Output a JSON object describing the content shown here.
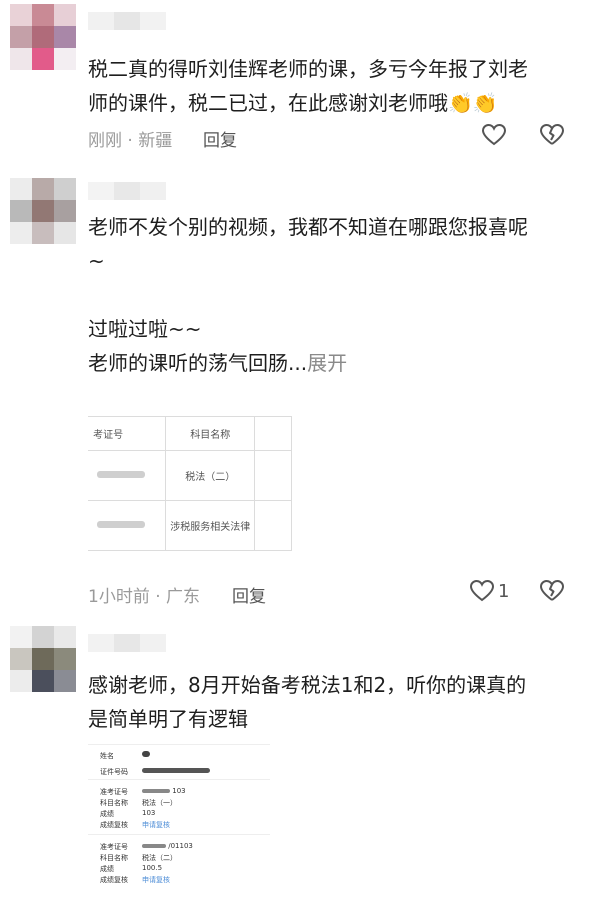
{
  "comments": [
    {
      "lines": [
        "税二真的得听刘佳辉老师的课，多亏今年报了刘老",
        "师的课件，税二已过，在此感谢刘老师哦👏👏"
      ],
      "time": "刚刚 · 新疆",
      "reply": "回复",
      "likes": ""
    },
    {
      "lines": [
        "老师不发个别的视频，我都不知道在哪跟您报喜呢",
        "~",
        "",
        "过啦过啦~~",
        "老师的课听的荡气回肠..."
      ],
      "expand": "展开",
      "time": "1小时前 · 广东",
      "reply": "回复",
      "likes": "1",
      "table": {
        "headers": [
          "考证号",
          "科目名称"
        ],
        "rows": [
          "税法（二）",
          "涉税服务相关法律"
        ]
      }
    },
    {
      "lines": [
        "感谢老师，8月开始备考税法1和2，听你的课真的",
        "是简单明了有逻辑"
      ],
      "scores": {
        "name_label": "姓名",
        "id_label": "证件号码",
        "blocks": [
          {
            "ticket_label": "准考证号",
            "ticket": "103",
            "subject_label": "科目名称",
            "subject": "税法（一）",
            "score_label": "成绩",
            "score": "103",
            "review_label": "成绩复核",
            "review": "申请复核"
          },
          {
            "ticket_label": "准考证号",
            "ticket": "/01103",
            "subject_label": "科目名称",
            "subject": "税法（二）",
            "score_label": "成绩",
            "score": "100.5",
            "review_label": "成绩复核",
            "review": "申请复核"
          }
        ]
      }
    }
  ],
  "colors": {
    "text": "#1e1e1e",
    "meta": "#9a9a9a",
    "link": "#4a8bd6"
  },
  "icons": [
    "heart-outline-icon",
    "broken-heart-icon"
  ]
}
